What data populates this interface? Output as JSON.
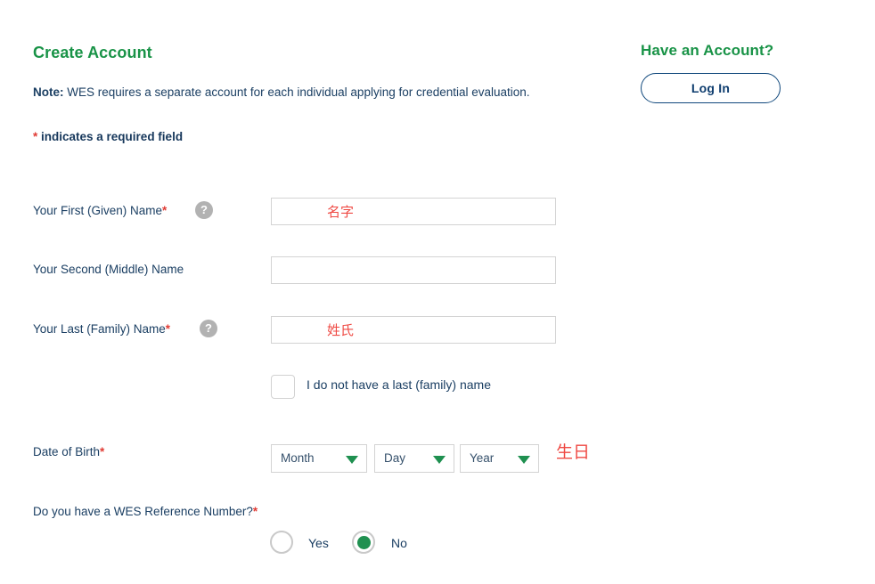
{
  "page": {
    "title": "Create Account",
    "note_strong": "Note:",
    "note_text": " WES requires a separate account for each individual applying for credential evaluation.",
    "required_star": "*",
    "required_text": " indicates a required field"
  },
  "aside": {
    "title": "Have an Account?",
    "login_label": "Log In"
  },
  "form": {
    "first_name": {
      "label": "Your First (Given) Name",
      "required_mark": "*",
      "help_glyph": "?",
      "value": "名字",
      "placeholder": ""
    },
    "middle_name": {
      "label": "Your Second (Middle) Name",
      "value": "",
      "placeholder": ""
    },
    "last_name": {
      "label": "Your Last (Family) Name",
      "required_mark": "*",
      "help_glyph": "?",
      "value": "姓氏",
      "placeholder": ""
    },
    "no_last_name": {
      "label": "I do not have a last (family) name",
      "checked": false
    },
    "date_of_birth": {
      "label": "Date of Birth",
      "required_mark": "*",
      "month": "Month",
      "day": "Day",
      "year": "Year",
      "annotation": "生日"
    },
    "wes_reference": {
      "label": "Do you have a WES Reference Number?",
      "required_mark": "*",
      "yes_label": "Yes",
      "no_label": "No",
      "selected": "No"
    }
  },
  "colors": {
    "brand_green": "#199347",
    "navy": "#1b3f63",
    "button_border": "#10487c",
    "required_red": "#e03b34",
    "annotation_red": "#ef4a44",
    "input_border": "#d3d3d3",
    "help_gray": "#b2b2b2"
  }
}
